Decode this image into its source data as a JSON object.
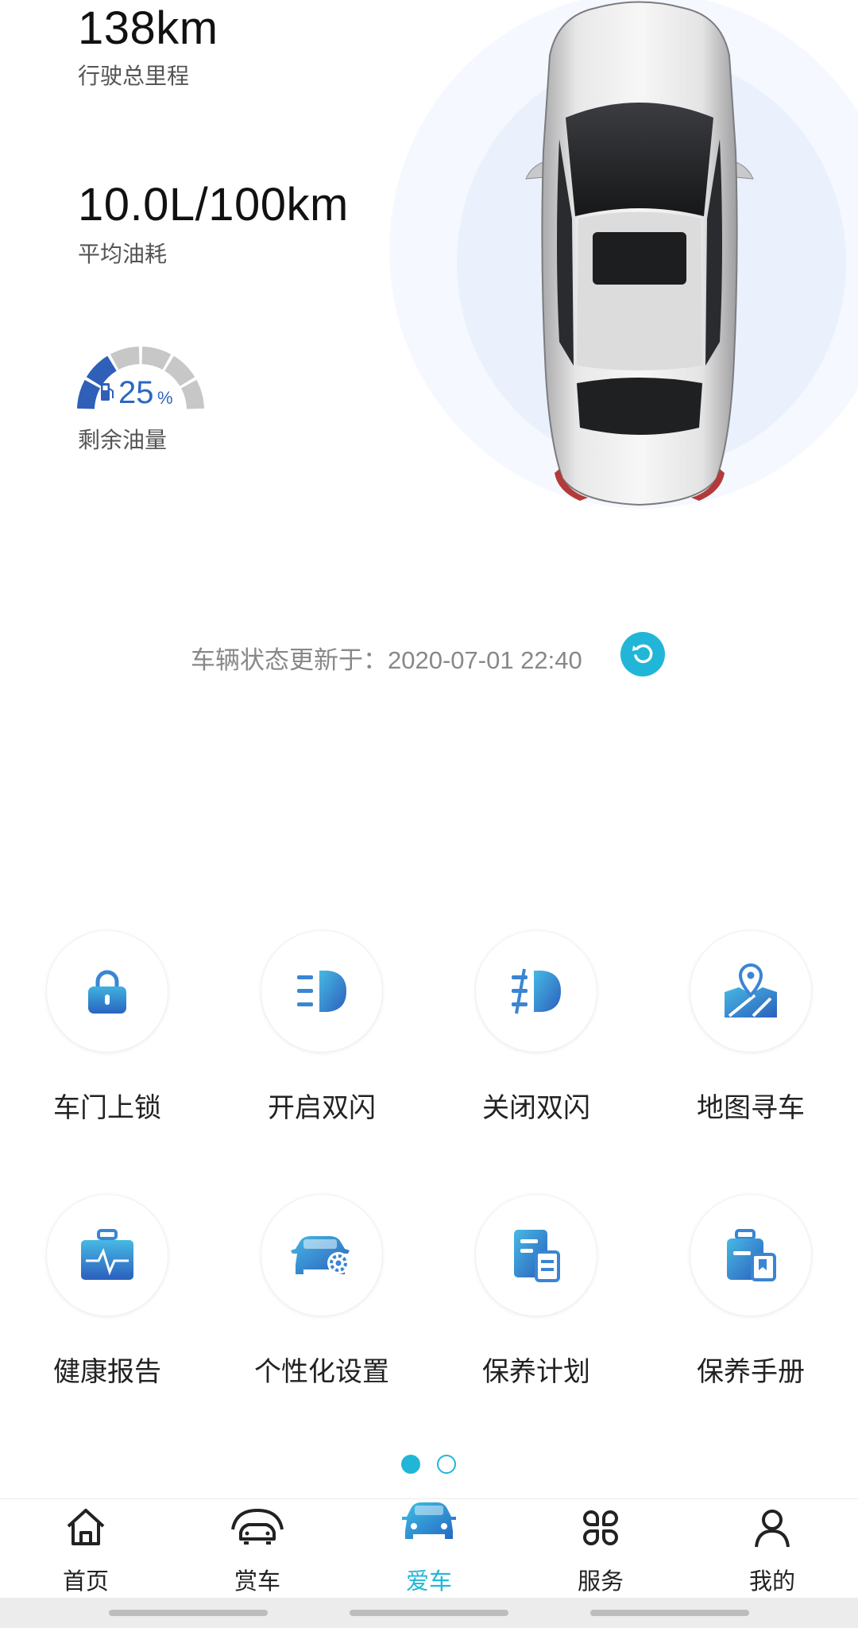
{
  "stats": {
    "mileage_value": "138km",
    "mileage_label": "行驶总里程",
    "fuel_consumption_value": "10.0L/100km",
    "fuel_consumption_label": "平均油耗",
    "fuel_level_value": "25",
    "fuel_level_unit": "%",
    "fuel_level_label": "剩余油量",
    "fuel_level_fraction": 0.25
  },
  "status": {
    "update_text": "车辆状态更新于：2020-07-01 22:40"
  },
  "actions": [
    {
      "label": "车门上锁",
      "icon": "lock-icon"
    },
    {
      "label": "开启双闪",
      "icon": "hazard-lights-on-icon"
    },
    {
      "label": "关闭双闪",
      "icon": "hazard-lights-off-icon"
    },
    {
      "label": "地图寻车",
      "icon": "map-pin-icon"
    },
    {
      "label": "健康报告",
      "icon": "health-report-icon"
    },
    {
      "label": "个性化设置",
      "icon": "car-settings-icon"
    },
    {
      "label": "保养计划",
      "icon": "maintenance-plan-icon"
    },
    {
      "label": "保养手册",
      "icon": "maintenance-manual-icon"
    }
  ],
  "pager": {
    "current": 1,
    "total": 2
  },
  "nav": [
    {
      "label": "首页",
      "icon": "home-icon",
      "active": false
    },
    {
      "label": "赏车",
      "icon": "car-outline-icon",
      "active": false
    },
    {
      "label": "爱车",
      "icon": "car-filled-icon",
      "active": true
    },
    {
      "label": "服务",
      "icon": "services-grid-icon",
      "active": false
    },
    {
      "label": "我的",
      "icon": "profile-icon",
      "active": false
    }
  ],
  "colors": {
    "accent": "#21b6d8",
    "icon_blue": "#3a7ad0",
    "gauge_blue": "#2f5fb8",
    "gauge_gray": "#c7c7c7"
  }
}
